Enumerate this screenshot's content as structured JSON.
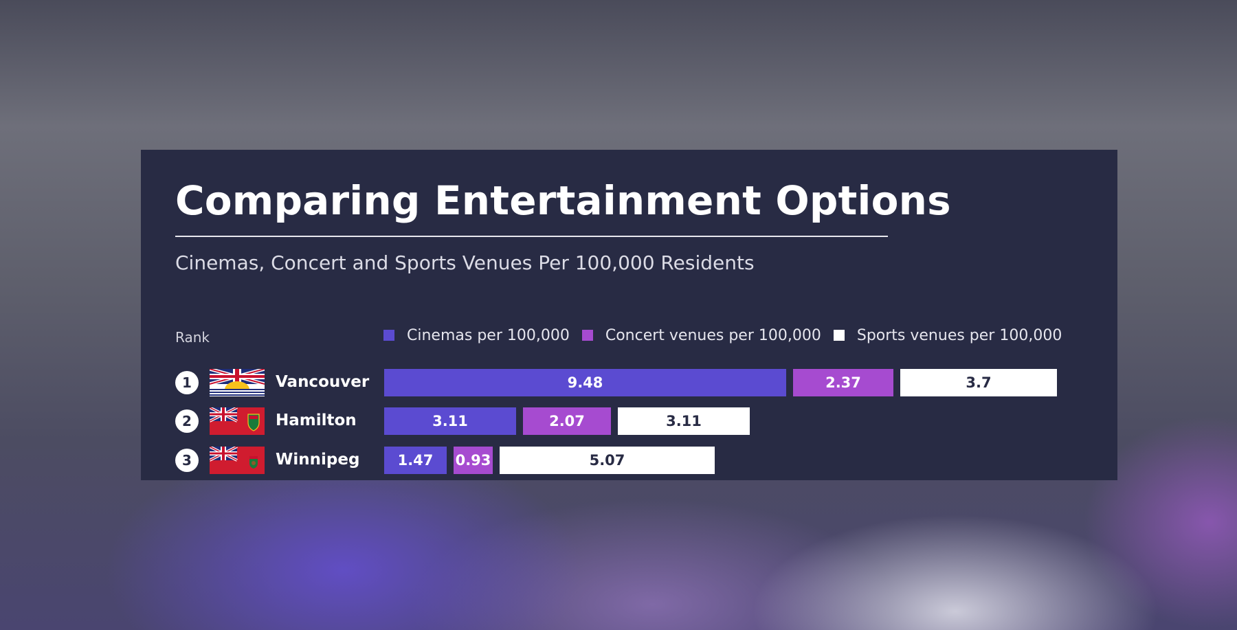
{
  "title": "Comparing Entertainment Options",
  "subtitle": "Cinemas, Concert and Sports Venues Per 100,000 Residents",
  "rank_header": "Rank",
  "colors": {
    "cinemas": "#5b4bd1",
    "concert": "#a64bd0",
    "sports": "#ffffff",
    "panel": "#282b44",
    "sports_text": "#282b44"
  },
  "chart_data": {
    "type": "bar",
    "orientation": "horizontal",
    "stacked": true,
    "categories": [
      "Vancouver",
      "Hamilton",
      "Winnipeg"
    ],
    "ranks": [
      "1",
      "2",
      "3"
    ],
    "flag_icons": [
      "british-columbia-flag-icon",
      "ontario-flag-icon",
      "manitoba-flag-icon"
    ],
    "legend_position": "top",
    "grid": false,
    "series": [
      {
        "name": "Cinemas per 100,000",
        "values": [
          9.48,
          3.11,
          1.47
        ]
      },
      {
        "name": "Concert venues per 100,000",
        "values": [
          2.37,
          2.07,
          0.93
        ]
      },
      {
        "name": "Sports venues per 100,000",
        "values": [
          3.7,
          3.11,
          5.07
        ]
      }
    ],
    "data_labels": [
      [
        "9.48",
        "2.37",
        "3.7"
      ],
      [
        "3.11",
        "2.07",
        "3.11"
      ],
      [
        "1.47",
        "0.93",
        "5.07"
      ]
    ]
  }
}
